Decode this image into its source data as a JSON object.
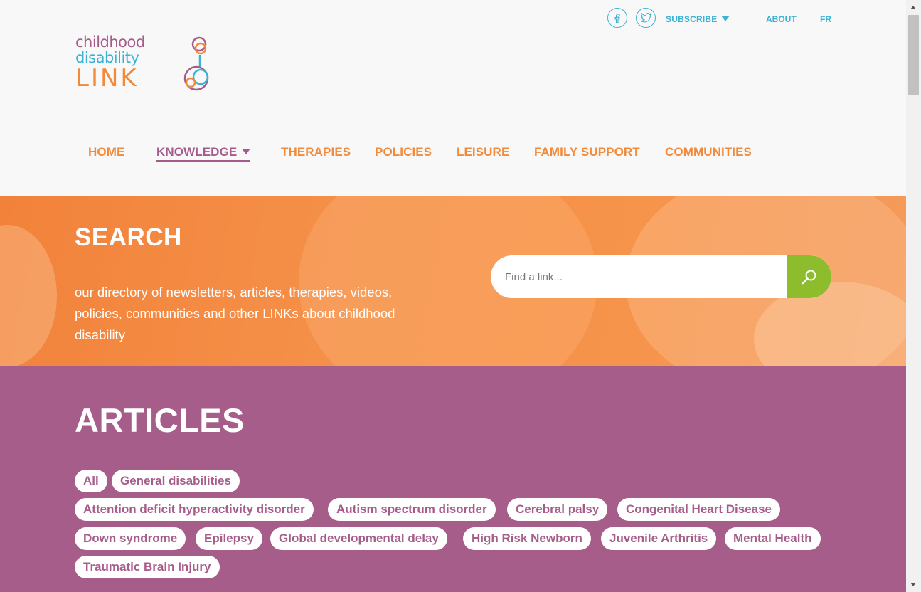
{
  "brand": {
    "logo_line1": "childhood",
    "logo_line2": "disability",
    "logo_line3": "LINK"
  },
  "topbar": {
    "facebook_icon": "facebook-icon",
    "twitter_icon": "twitter-icon",
    "subscribe_label": "SUBSCRIBE",
    "about_label": "ABOUT",
    "language_label": "FR",
    "accent_color": "#3bb1d4"
  },
  "nav": {
    "items": [
      {
        "label": "HOME"
      },
      {
        "label": "KNOWLEDGE",
        "active": true
      },
      {
        "label": "THERAPIES"
      },
      {
        "label": "POLICIES"
      },
      {
        "label": "LEISURE"
      },
      {
        "label": "FAMILY SUPPORT"
      },
      {
        "label": "COMMUNITIES"
      }
    ],
    "color": "#f28a3a",
    "active_color": "#a55c8a"
  },
  "search": {
    "title": "SEARCH",
    "description": "our directory of newsletters, articles, therapies, videos, policies, communities and other LINKs about childhood disability",
    "placeholder": "Find a link...",
    "button_icon": "search-icon",
    "band_color": "#f2823a",
    "button_color": "#8dbd2c"
  },
  "articles": {
    "title": "ARTICLES",
    "background_color": "#a65d8a",
    "tags": [
      "All",
      "General disabilities",
      "Attention deficit hyperactivity disorder",
      "Autism spectrum disorder",
      "Cerebral palsy",
      "Congenital Heart Disease",
      "Down syndrome",
      "Epilepsy",
      "Global developmental delay",
      "High Risk Newborn",
      "Juvenile Arthritis",
      "Mental Health",
      "Traumatic Brain Injury"
    ]
  }
}
